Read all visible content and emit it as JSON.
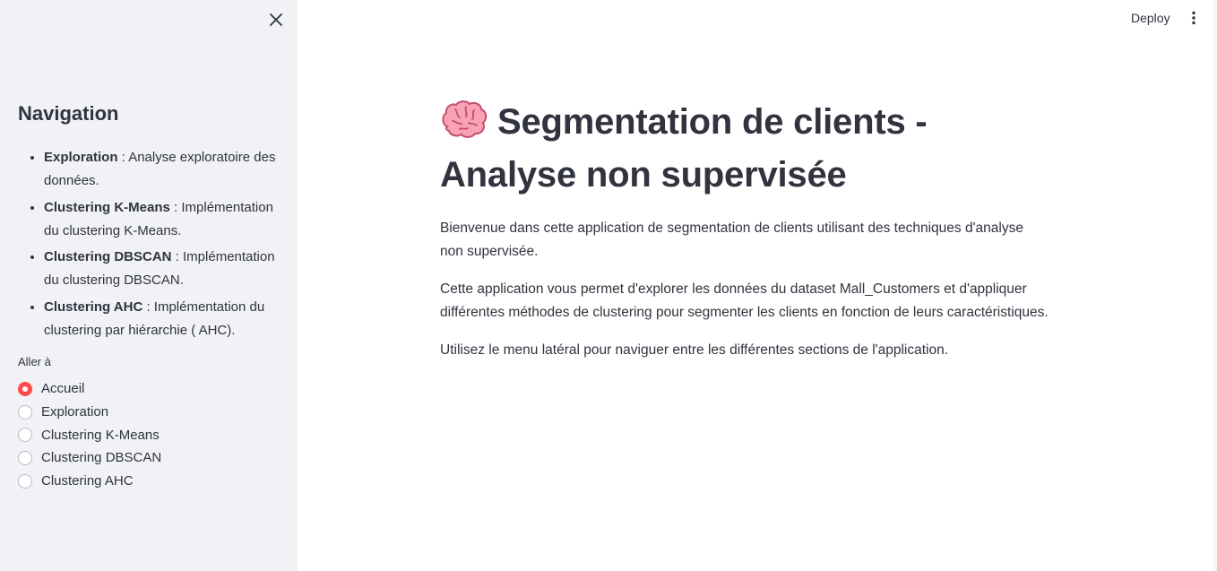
{
  "sidebar": {
    "title": "Navigation",
    "items": [
      {
        "bold": "Exploration",
        "rest": " : Analyse exploratoire des données."
      },
      {
        "bold": "Clustering K-Means",
        "rest": " : Implémentation du clustering K-Means."
      },
      {
        "bold": "Clustering DBSCAN",
        "rest": " : Implémentation du clustering DBSCAN."
      },
      {
        "bold": "Clustering AHC",
        "rest": " : Implémentation du clustering par hiérarchie ( AHC)."
      }
    ],
    "radio_label": "Aller à",
    "radio_options": [
      "Accueil",
      "Exploration",
      "Clustering K-Means",
      "Clustering DBSCAN",
      "Clustering AHC"
    ],
    "selected": "Accueil"
  },
  "header": {
    "deploy_label": "Deploy"
  },
  "main": {
    "title": "Segmentation de clients - Analyse non supervisée",
    "paragraphs": [
      "Bienvenue dans cette application de segmentation de clients utilisant des techniques d'analyse non supervisée.",
      "Cette application vous permet d'explorer les données du dataset Mall_Customers et d'appliquer différentes méthodes de clustering pour segmenter les clients en fonction de leurs caractéristiques.",
      "Utilisez le menu latéral pour naviguer entre les différentes sections de l'application."
    ]
  },
  "colors": {
    "accent": "#ff4b4b",
    "sidebar_bg": "#f0f2f6",
    "text": "#31333f"
  },
  "icons": [
    "close-icon",
    "brain-icon",
    "more-vertical-icon"
  ]
}
